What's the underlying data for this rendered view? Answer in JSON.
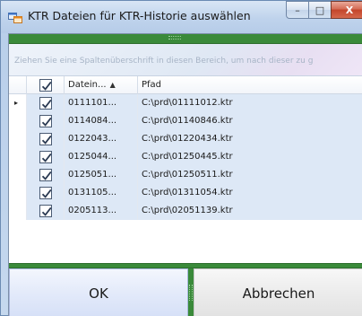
{
  "window": {
    "title": "KTR Dateien für KTR-Historie auswählen",
    "caption_minimize": "–",
    "caption_maximize": "□",
    "caption_close": "X"
  },
  "group_panel": {
    "hint": "Ziehen Sie eine Spaltenüberschrift in diesen Bereich, um nach dieser zu g"
  },
  "grid": {
    "columns": {
      "file": "Datein...",
      "path": "Pfad"
    },
    "current_row_indicator": "▸",
    "sort_indicator": "▲",
    "rows": [
      {
        "checked": true,
        "file": "0111101...",
        "path": "C:\\prd\\01111012.ktr"
      },
      {
        "checked": true,
        "file": "0114084...",
        "path": "C:\\prd\\01140846.ktr"
      },
      {
        "checked": true,
        "file": "0122043...",
        "path": "C:\\prd\\01220434.ktr"
      },
      {
        "checked": true,
        "file": "0125044...",
        "path": "C:\\prd\\01250445.ktr"
      },
      {
        "checked": true,
        "file": "0125051...",
        "path": "C:\\prd\\01250511.ktr"
      },
      {
        "checked": true,
        "file": "0131105...",
        "path": "C:\\prd\\01311054.ktr"
      },
      {
        "checked": true,
        "file": "0205113...",
        "path": "C:\\prd\\02051139.ktr"
      }
    ]
  },
  "buttons": {
    "ok": "OK",
    "cancel": "Abbrechen"
  },
  "colors": {
    "splitter": "#3a8a3a",
    "row_selected_bg": "#dde8f6"
  },
  "icons": {
    "app": "app-window-icon",
    "check": "checkmark-icon"
  }
}
